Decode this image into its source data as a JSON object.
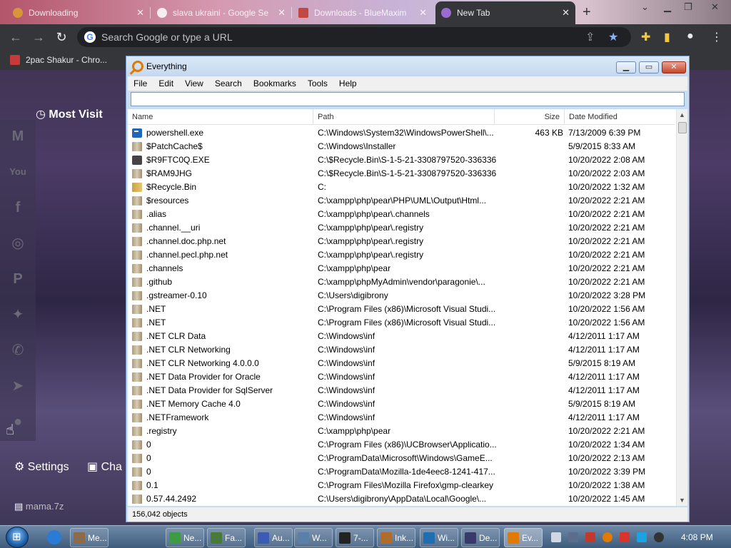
{
  "browser": {
    "tabs": [
      {
        "title": "Downloading",
        "active": false
      },
      {
        "title": "slava ukraini - Google Se",
        "active": false
      },
      {
        "title": "Downloads - BlueMaxim",
        "active": false
      },
      {
        "title": "New Tab",
        "active": true
      }
    ],
    "omnibox_placeholder": "Search Google or type a URL",
    "bookmarks": [
      "2pac Shakur - Chro..."
    ]
  },
  "ntp": {
    "most_visited_label": "Most Visit",
    "settings_label": "Settings",
    "change_label": "Cha",
    "download_item": "mama.7z",
    "social_icons": [
      "gmail-icon",
      "youtube-icon",
      "facebook-icon",
      "instagram-icon",
      "pinterest-icon",
      "twitter-icon",
      "whatsapp-icon",
      "telegram-icon",
      "reddit-icon"
    ]
  },
  "everything": {
    "title": "Everything",
    "menu": [
      "File",
      "Edit",
      "View",
      "Search",
      "Bookmarks",
      "Tools",
      "Help"
    ],
    "search_value": "",
    "columns": {
      "name": "Name",
      "path": "Path",
      "size": "Size",
      "date": "Date Modified"
    },
    "rows": [
      {
        "icon": "exe",
        "name": "powershell.exe",
        "path": "C:\\Windows\\System32\\WindowsPowerShell\\...",
        "size": "463 KB",
        "date": "7/13/2009 6:39 PM"
      },
      {
        "icon": "folder",
        "name": "$PatchCache$",
        "path": "C:\\Windows\\Installer",
        "size": "",
        "date": "5/9/2015 8:33 AM"
      },
      {
        "icon": "exe2",
        "name": "$R9FTC0Q.EXE",
        "path": "C:\\$Recycle.Bin\\S-1-5-21-3308797520-336336...",
        "size": "",
        "date": "10/20/2022 2:08 AM"
      },
      {
        "icon": "folder",
        "name": "$RAM9JHG",
        "path": "C:\\$Recycle.Bin\\S-1-5-21-3308797520-336336...",
        "size": "",
        "date": "10/20/2022 2:03 AM"
      },
      {
        "icon": "locked",
        "name": "$Recycle.Bin",
        "path": "C:",
        "size": "",
        "date": "10/20/2022 1:32 AM"
      },
      {
        "icon": "folder",
        "name": "$resources",
        "path": "C:\\xampp\\php\\pear\\PHP\\UML\\Output\\Html...",
        "size": "",
        "date": "10/20/2022 2:21 AM"
      },
      {
        "icon": "folder",
        "name": ".alias",
        "path": "C:\\xampp\\php\\pear\\.channels",
        "size": "",
        "date": "10/20/2022 2:21 AM"
      },
      {
        "icon": "folder",
        "name": ".channel.__uri",
        "path": "C:\\xampp\\php\\pear\\.registry",
        "size": "",
        "date": "10/20/2022 2:21 AM"
      },
      {
        "icon": "folder",
        "name": ".channel.doc.php.net",
        "path": "C:\\xampp\\php\\pear\\.registry",
        "size": "",
        "date": "10/20/2022 2:21 AM"
      },
      {
        "icon": "folder",
        "name": ".channel.pecl.php.net",
        "path": "C:\\xampp\\php\\pear\\.registry",
        "size": "",
        "date": "10/20/2022 2:21 AM"
      },
      {
        "icon": "folder",
        "name": ".channels",
        "path": "C:\\xampp\\php\\pear",
        "size": "",
        "date": "10/20/2022 2:21 AM"
      },
      {
        "icon": "folder",
        "name": ".github",
        "path": "C:\\xampp\\phpMyAdmin\\vendor\\paragonie\\...",
        "size": "",
        "date": "10/20/2022 2:21 AM"
      },
      {
        "icon": "folder",
        "name": ".gstreamer-0.10",
        "path": "C:\\Users\\digibrony",
        "size": "",
        "date": "10/20/2022 3:28 PM"
      },
      {
        "icon": "folder",
        "name": ".NET",
        "path": "C:\\Program Files (x86)\\Microsoft Visual Studi...",
        "size": "",
        "date": "10/20/2022 1:56 AM"
      },
      {
        "icon": "folder",
        "name": ".NET",
        "path": "C:\\Program Files (x86)\\Microsoft Visual Studi...",
        "size": "",
        "date": "10/20/2022 1:56 AM"
      },
      {
        "icon": "folder",
        "name": ".NET CLR Data",
        "path": "C:\\Windows\\inf",
        "size": "",
        "date": "4/12/2011 1:17 AM"
      },
      {
        "icon": "folder",
        "name": ".NET CLR Networking",
        "path": "C:\\Windows\\inf",
        "size": "",
        "date": "4/12/2011 1:17 AM"
      },
      {
        "icon": "folder",
        "name": ".NET CLR Networking 4.0.0.0",
        "path": "C:\\Windows\\inf",
        "size": "",
        "date": "5/9/2015 8:19 AM"
      },
      {
        "icon": "folder",
        "name": ".NET Data Provider for Oracle",
        "path": "C:\\Windows\\inf",
        "size": "",
        "date": "4/12/2011 1:17 AM"
      },
      {
        "icon": "folder",
        "name": ".NET Data Provider for SqlServer",
        "path": "C:\\Windows\\inf",
        "size": "",
        "date": "4/12/2011 1:17 AM"
      },
      {
        "icon": "folder",
        "name": ".NET Memory Cache 4.0",
        "path": "C:\\Windows\\inf",
        "size": "",
        "date": "5/9/2015 8:19 AM"
      },
      {
        "icon": "folder",
        "name": ".NETFramework",
        "path": "C:\\Windows\\inf",
        "size": "",
        "date": "4/12/2011 1:17 AM"
      },
      {
        "icon": "folder",
        "name": ".registry",
        "path": "C:\\xampp\\php\\pear",
        "size": "",
        "date": "10/20/2022 2:21 AM"
      },
      {
        "icon": "folder",
        "name": "0",
        "path": "C:\\Program Files (x86)\\UCBrowser\\Applicatio...",
        "size": "",
        "date": "10/20/2022 1:34 AM"
      },
      {
        "icon": "folder",
        "name": "0",
        "path": "C:\\ProgramData\\Microsoft\\Windows\\GameE...",
        "size": "",
        "date": "10/20/2022 2:13 AM"
      },
      {
        "icon": "folder",
        "name": "0",
        "path": "C:\\ProgramData\\Mozilla-1de4eec8-1241-417...",
        "size": "",
        "date": "10/20/2022 3:39 PM"
      },
      {
        "icon": "folder",
        "name": "0.1",
        "path": "C:\\Program Files\\Mozilla Firefox\\gmp-clearkey",
        "size": "",
        "date": "10/20/2022 1:38 AM"
      },
      {
        "icon": "folder",
        "name": "0.57.44.2492",
        "path": "C:\\Users\\digibrony\\AppData\\Local\\Google\\...",
        "size": "",
        "date": "10/20/2022 1:45 AM"
      }
    ],
    "status": "156,042 objects"
  },
  "taskbar": {
    "items": [
      {
        "label": "Me...",
        "color": "#8b6b4a"
      },
      {
        "label": "Ne...",
        "color": "#3d9b46"
      },
      {
        "label": "Fa...",
        "color": "#4a7a3a"
      },
      {
        "label": "Au...",
        "color": "#3b5bb5"
      },
      {
        "label": "W...",
        "color": "#5a7fa8"
      },
      {
        "label": "7-...",
        "color": "#222222"
      },
      {
        "label": "Ink...",
        "color": "#b06c2a"
      },
      {
        "label": "Wi...",
        "color": "#1f6fb0"
      },
      {
        "label": "De...",
        "color": "#3a3a6a"
      },
      {
        "label": "Ev...",
        "color": "#e07a00"
      }
    ],
    "clock": "4:08 PM"
  }
}
